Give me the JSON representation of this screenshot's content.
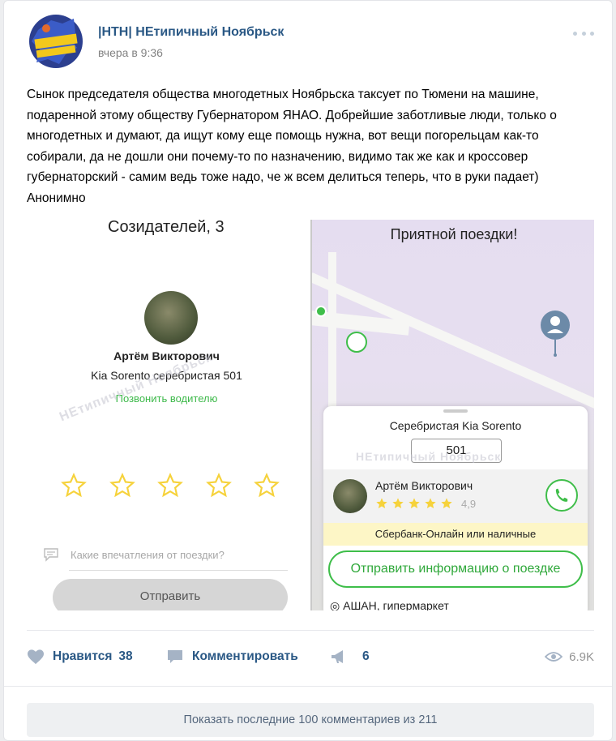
{
  "post": {
    "author": "|НТН| НЕтипичный Ноябрьск",
    "time": "вчера в 9:36",
    "text": "Сынок председателя общества многодетных Ноябрьска таксует по Тюмени на машине, подаренной этому обществу Губернатором ЯНАО. Добрейшие заботливые люди, только о многодетных и думают, да ищут кому еще помощь нужна, вот вещи погорельцам как-то собирали, да не дошли они почему-то по назначению, видимо так же как и кроссовер губернаторский - самим ведь тоже надо, че ж всем делиться теперь, что в руки падает) Анонимно"
  },
  "left_screenshot": {
    "title": "Созидателей, 3",
    "driver_name": "Артём Викторович",
    "car": "Kia Sorento серебристая  501",
    "call_driver": "Позвонить водителю",
    "comment_placeholder": "Какие впечатления от поездки?",
    "send_button": "Отправить",
    "watermark": "НЕтипичный Ноябрьск",
    "stars_total": 5
  },
  "right_screenshot": {
    "title": "Приятной поездки!",
    "car": "Серебристая  Kia Sorento",
    "plate": "501",
    "watermark": "НЕтипичный Ноябрьск",
    "driver_name": "Артём Викторович",
    "rating": "4,9",
    "payment": "Сбербанк-Онлайн или наличные",
    "send_info_button": "Отправить информацию о поездке",
    "destination": "АШАН, гипермаркет"
  },
  "actions": {
    "like_label": "Нравится",
    "like_count": "38",
    "comment_label": "Комментировать",
    "share_count": "6",
    "views": "6.9K"
  },
  "comments": {
    "show_more": "Показать последние 100 комментариев из 211"
  },
  "colors": {
    "link": "#2a5885",
    "green": "#3fbe4a",
    "star": "#f6d23b"
  }
}
